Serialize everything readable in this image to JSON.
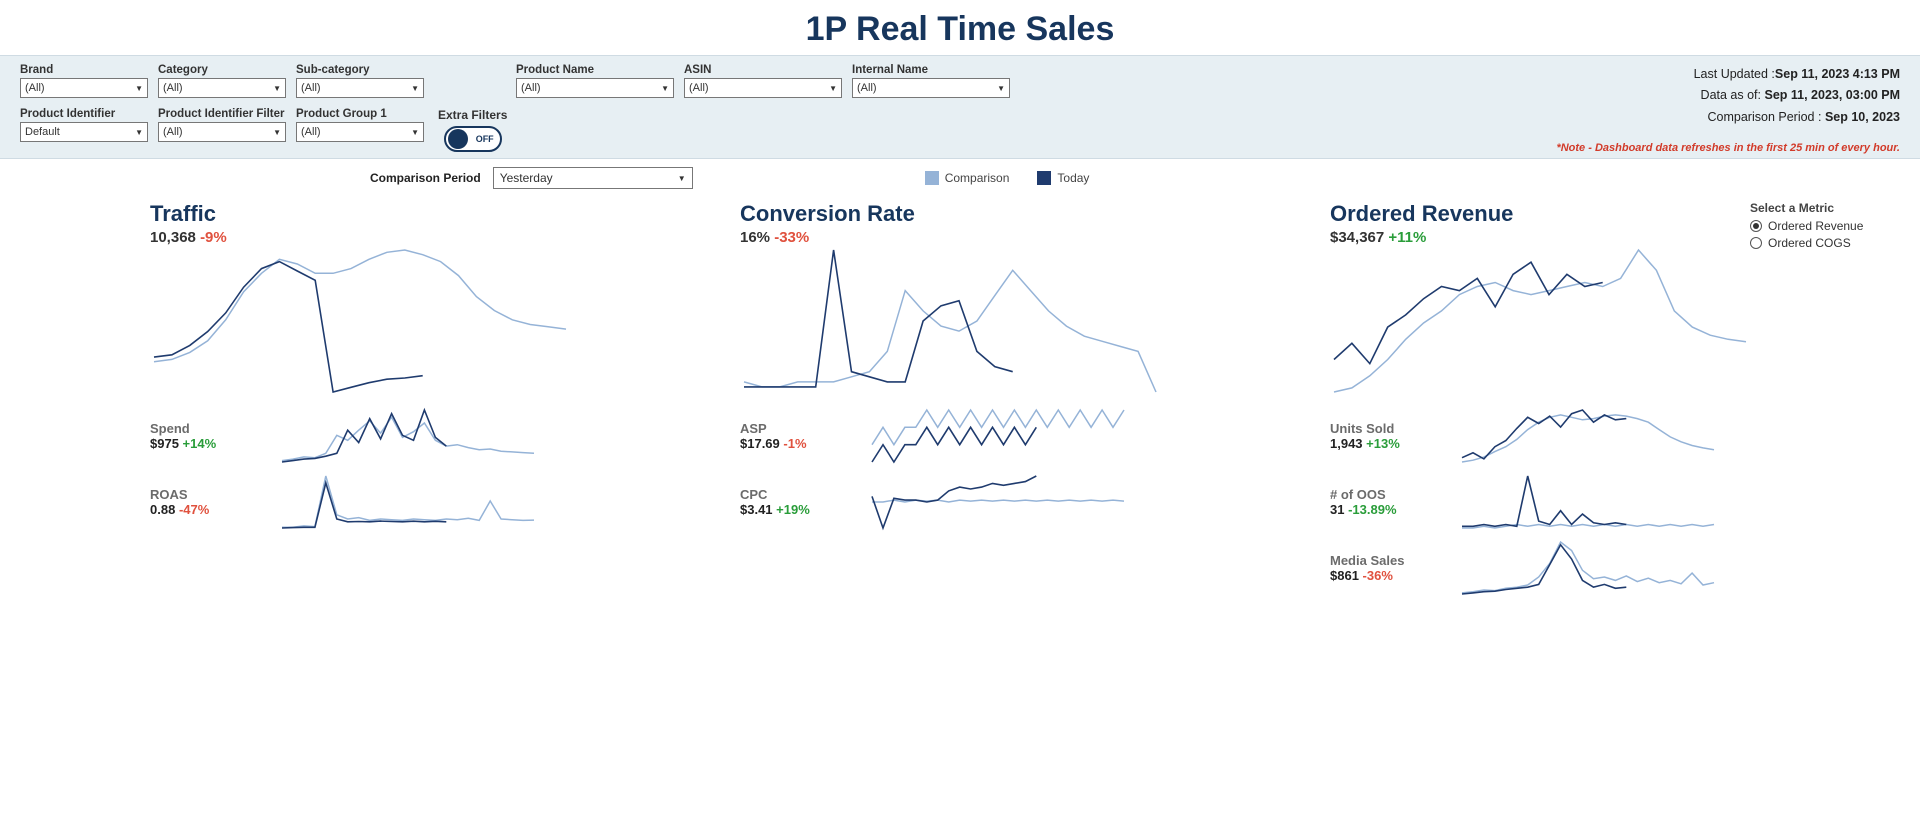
{
  "title": "1P Real Time Sales",
  "filters": {
    "row1": [
      {
        "label": "Brand",
        "value": "(All)"
      },
      {
        "label": "Category",
        "value": "(All)"
      },
      {
        "label": "Sub-category",
        "value": "(All)"
      },
      {
        "label": "Product Name",
        "value": "(All)"
      },
      {
        "label": "ASIN",
        "value": "(All)"
      },
      {
        "label": "Internal Name",
        "value": "(All)"
      }
    ],
    "row2": [
      {
        "label": "Product Identifier",
        "value": "Default"
      },
      {
        "label": "Product Identifier Filter",
        "value": "(All)"
      },
      {
        "label": "Product Group 1",
        "value": "(All)"
      }
    ],
    "extra_label": "Extra Filters",
    "toggle_text": "OFF"
  },
  "info": {
    "last_updated_label": "Last Updated :",
    "last_updated": "Sep 11, 2023 4:13 PM",
    "data_asof_label": "Data as of: ",
    "data_asof": "Sep 11, 2023, 03:00 PM",
    "comp_period_label": "Comparison Period :  ",
    "comp_period": "Sep 10, 2023",
    "note": "*Note - Dashboard data refreshes in the first 25 min of every hour."
  },
  "comparison": {
    "label": "Comparison Period",
    "value": "Yesterday",
    "legend_comp": "Comparison",
    "legend_today": "Today"
  },
  "metric_select": {
    "header": "Select a Metric",
    "opt1": "Ordered Revenue",
    "opt2": "Ordered COGS"
  },
  "metrics": {
    "traffic": {
      "title": "Traffic",
      "value": "10,368",
      "delta": "-9%",
      "pos": false
    },
    "conversion": {
      "title": "Conversion Rate",
      "value": "16%",
      "delta": "-33%",
      "pos": false
    },
    "revenue": {
      "title": "Ordered Revenue",
      "value": "$34,367",
      "delta": "+11%",
      "pos": true
    },
    "spend": {
      "title": "Spend",
      "value": "$975",
      "delta": "+14%",
      "pos": true
    },
    "roas": {
      "title": "ROAS",
      "value": "0.88",
      "delta": "-47%",
      "pos": false
    },
    "asp": {
      "title": "ASP",
      "value": "$17.69",
      "delta": "-1%",
      "pos": false
    },
    "cpc": {
      "title": "CPC",
      "value": "$3.41",
      "delta": "+19%",
      "pos": true
    },
    "units": {
      "title": "Units Sold",
      "value": "1,943",
      "delta": "+13%",
      "pos": true
    },
    "oos": {
      "title": "# of OOS",
      "value": "31",
      "delta": "-13.89%",
      "pos": true
    },
    "media": {
      "title": "Media Sales",
      "value": "$861",
      "delta": "-36%",
      "pos": false
    }
  },
  "chart_data": [
    {
      "id": "traffic",
      "type": "line",
      "x_hours": [
        0,
        1,
        2,
        3,
        4,
        5,
        6,
        7,
        8,
        9,
        10,
        11,
        12,
        13,
        14,
        15,
        16,
        17,
        18,
        19,
        20,
        21,
        22,
        23
      ],
      "series": [
        {
          "name": "Comparison",
          "values": [
            260,
            270,
            300,
            350,
            440,
            560,
            640,
            700,
            680,
            640,
            640,
            660,
            700,
            730,
            740,
            720,
            690,
            630,
            540,
            480,
            440,
            420,
            410,
            400
          ]
        },
        {
          "name": "Today",
          "values": [
            280,
            290,
            330,
            390,
            470,
            580,
            660,
            690,
            650,
            610,
            130,
            150,
            170,
            185,
            190,
            200
          ]
        }
      ]
    },
    {
      "id": "conversion",
      "type": "line",
      "x_hours": [
        0,
        1,
        2,
        3,
        4,
        5,
        6,
        7,
        8,
        9,
        10,
        11,
        12,
        13,
        14,
        15,
        16,
        17,
        18,
        19,
        20,
        21,
        22,
        23
      ],
      "series": [
        {
          "name": "Comparison",
          "values": [
            12,
            11,
            11,
            12,
            12,
            12,
            13,
            14,
            18,
            30,
            26,
            23,
            22,
            24,
            29,
            34,
            30,
            26,
            23,
            21,
            20,
            19,
            18,
            10
          ]
        },
        {
          "name": "Today",
          "values": [
            11,
            11,
            11,
            11,
            11,
            38,
            14,
            13,
            12,
            12,
            24,
            27,
            28,
            18,
            15,
            14
          ]
        }
      ]
    },
    {
      "id": "revenue",
      "type": "line",
      "x_hours": [
        0,
        1,
        2,
        3,
        4,
        5,
        6,
        7,
        8,
        9,
        10,
        11,
        12,
        13,
        14,
        15,
        16,
        17,
        18,
        19,
        20,
        21,
        22,
        23
      ],
      "series": [
        {
          "name": "Comparison",
          "values": [
            900,
            950,
            1100,
            1300,
            1550,
            1750,
            1900,
            2100,
            2200,
            2250,
            2150,
            2100,
            2150,
            2200,
            2250,
            2200,
            2300,
            2650,
            2400,
            1900,
            1700,
            1600,
            1550,
            1520
          ]
        },
        {
          "name": "Today",
          "values": [
            1300,
            1500,
            1250,
            1700,
            1850,
            2050,
            2200,
            2150,
            2300,
            1950,
            2350,
            2500,
            2100,
            2350,
            2200,
            2250
          ]
        }
      ]
    },
    {
      "id": "spend",
      "type": "line",
      "series": [
        {
          "name": "Comparison",
          "values": [
            20,
            22,
            25,
            24,
            30,
            55,
            48,
            62,
            75,
            58,
            80,
            52,
            60,
            72,
            48,
            40,
            42,
            38,
            35,
            36,
            33,
            32,
            31,
            30
          ]
        },
        {
          "name": "Today",
          "values": [
            18,
            20,
            22,
            23,
            26,
            30,
            62,
            45,
            78,
            50,
            85,
            55,
            48,
            90,
            52,
            40
          ]
        }
      ]
    },
    {
      "id": "roas",
      "type": "line",
      "series": [
        {
          "name": "Comparison",
          "values": [
            0.3,
            0.3,
            0.4,
            0.35,
            4.0,
            1.2,
            0.9,
            1.0,
            0.8,
            0.9,
            0.85,
            0.8,
            0.9,
            0.85,
            0.8,
            0.9,
            0.85,
            0.95,
            0.8,
            2.2,
            0.9,
            0.85,
            0.8,
            0.82
          ]
        },
        {
          "name": "Today",
          "values": [
            0.25,
            0.28,
            0.3,
            0.3,
            3.5,
            0.9,
            0.7,
            0.72,
            0.7,
            0.75,
            0.72,
            0.7,
            0.74,
            0.7,
            0.73,
            0.7
          ]
        }
      ]
    },
    {
      "id": "asp",
      "type": "line",
      "series": [
        {
          "name": "Comparison",
          "values": [
            17.6,
            17.7,
            17.6,
            17.7,
            17.7,
            17.8,
            17.7,
            17.8,
            17.7,
            17.8,
            17.7,
            17.8,
            17.7,
            17.8,
            17.7,
            17.8,
            17.7,
            17.8,
            17.7,
            17.8,
            17.7,
            17.8,
            17.7,
            17.8
          ]
        },
        {
          "name": "Today",
          "values": [
            17.5,
            17.6,
            17.5,
            17.6,
            17.6,
            17.7,
            17.6,
            17.7,
            17.6,
            17.7,
            17.6,
            17.7,
            17.6,
            17.7,
            17.6,
            17.7
          ]
        }
      ]
    },
    {
      "id": "cpc",
      "type": "line",
      "series": [
        {
          "name": "Comparison",
          "values": [
            3.2,
            3.2,
            3.3,
            3.2,
            3.3,
            3.25,
            3.3,
            3.2,
            3.3,
            3.25,
            3.3,
            3.25,
            3.3,
            3.25,
            3.3,
            3.25,
            3.3,
            3.25,
            3.3,
            3.25,
            3.3,
            3.25,
            3.3,
            3.25
          ]
        },
        {
          "name": "Today",
          "values": [
            3.5,
            1.8,
            3.4,
            3.3,
            3.3,
            3.2,
            3.3,
            3.8,
            4.0,
            3.9,
            4.0,
            4.2,
            4.1,
            4.2,
            4.3,
            4.6
          ]
        }
      ]
    },
    {
      "id": "units",
      "type": "line",
      "series": [
        {
          "name": "Comparison",
          "values": [
            55,
            58,
            63,
            72,
            80,
            92,
            108,
            120,
            128,
            132,
            128,
            124,
            126,
            130,
            132,
            130,
            126,
            120,
            108,
            96,
            88,
            82,
            78,
            75
          ]
        },
        {
          "name": "Today",
          "values": [
            62,
            70,
            60,
            80,
            90,
            110,
            128,
            118,
            130,
            112,
            134,
            140,
            120,
            132,
            124,
            126
          ]
        }
      ]
    },
    {
      "id": "oos",
      "type": "line",
      "series": [
        {
          "name": "Comparison",
          "values": [
            28,
            28,
            29,
            28,
            29,
            30,
            29,
            30,
            29,
            30,
            29,
            30,
            29,
            30,
            29,
            30,
            29,
            30,
            29,
            30,
            29,
            30,
            29,
            30
          ]
        },
        {
          "name": "Today",
          "values": [
            29,
            29,
            30,
            29,
            30,
            29,
            58,
            32,
            30,
            38,
            30,
            36,
            31,
            30,
            31,
            30
          ]
        }
      ]
    },
    {
      "id": "media",
      "type": "line",
      "series": [
        {
          "name": "Comparison",
          "values": [
            20,
            22,
            25,
            24,
            28,
            30,
            34,
            48,
            72,
            110,
            95,
            60,
            45,
            48,
            42,
            50,
            40,
            46,
            38,
            42,
            36,
            55,
            34,
            38
          ]
        },
        {
          "name": "Today",
          "values": [
            18,
            20,
            22,
            23,
            26,
            28,
            30,
            35,
            70,
            105,
            80,
            42,
            30,
            35,
            28,
            30
          ]
        }
      ]
    }
  ]
}
